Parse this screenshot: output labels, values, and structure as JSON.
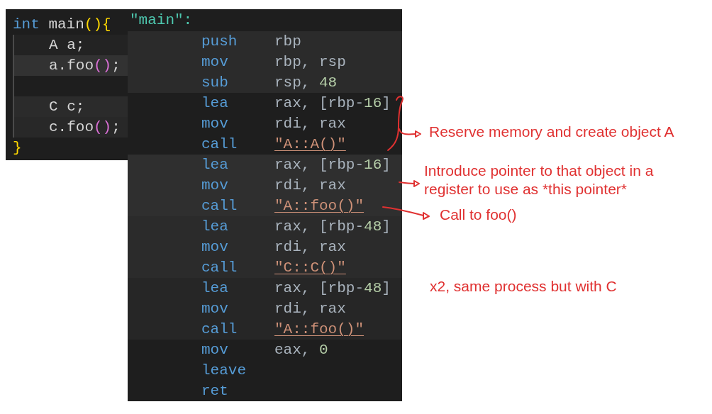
{
  "source": {
    "lines": [
      {
        "kind": "code",
        "tokens": [
          {
            "text": "int",
            "kind": "keyword"
          },
          {
            "text": " main",
            "kind": "identifier"
          },
          {
            "text": "(){",
            "kind": "bracket"
          }
        ],
        "children": [
          {
            "kind": "code",
            "color": "#232323",
            "tokens": [
              {
                "text": "A a;",
                "kind": "identifier"
              }
            ]
          },
          {
            "kind": "code",
            "color": "#323232",
            "tokens": [
              {
                "text": "a.foo",
                "kind": "identifier"
              },
              {
                "text": "()",
                "kind": "subbracket"
              },
              {
                "text": ";",
                "kind": "identifier"
              }
            ]
          },
          {
            "kind": "blank"
          },
          {
            "kind": "code",
            "color": "#2b2b2b",
            "tokens": [
              {
                "text": "C c;",
                "kind": "identifier"
              }
            ]
          },
          {
            "kind": "code",
            "color": "#282828",
            "tokens": [
              {
                "text": "c.foo",
                "kind": "identifier"
              },
              {
                "text": "()",
                "kind": "subbracket"
              },
              {
                "text": ";",
                "kind": "identifier"
              }
            ]
          }
        ]
      },
      {
        "kind": "code",
        "tokens": [
          {
            "text": "}",
            "kind": "bracket"
          }
        ]
      }
    ]
  },
  "assembly": {
    "label": "\"main\":",
    "blocks": [
      {
        "color": "#2b2b2b",
        "rows": [
          {
            "mnemonic": "push",
            "operands": [
              {
                "text": "rbp",
                "kind": "register"
              }
            ]
          },
          {
            "mnemonic": "mov",
            "operands": [
              {
                "text": "rbp, rsp",
                "kind": "register"
              }
            ]
          },
          {
            "mnemonic": "sub",
            "operands": [
              {
                "text": "rsp, ",
                "kind": "register"
              },
              {
                "text": "48",
                "kind": "number"
              }
            ]
          }
        ]
      },
      {
        "rows": [
          {
            "mnemonic": "lea",
            "operands": [
              {
                "text": "rax, [rbp-",
                "kind": "register"
              },
              {
                "text": "16",
                "kind": "number"
              },
              {
                "text": "]",
                "kind": "register"
              }
            ]
          },
          {
            "mnemonic": "mov",
            "operands": [
              {
                "text": "rdi, rax",
                "kind": "register"
              }
            ]
          },
          {
            "mnemonic": "call",
            "target": "\"A::A()\""
          }
        ]
      },
      {
        "color": "#2f2f2f",
        "rows": [
          {
            "mnemonic": "lea",
            "operands": [
              {
                "text": "rax, [rbp-",
                "kind": "register"
              },
              {
                "text": "16",
                "kind": "number"
              },
              {
                "text": "]",
                "kind": "register"
              }
            ]
          },
          {
            "mnemonic": "mov",
            "operands": [
              {
                "text": "rdi, rax",
                "kind": "register"
              }
            ]
          },
          {
            "mnemonic": "call",
            "target": "\"A::foo()\""
          }
        ]
      },
      {
        "color": "#2b2b2b",
        "rows": [
          {
            "mnemonic": "lea",
            "operands": [
              {
                "text": "rax, [rbp-",
                "kind": "register"
              },
              {
                "text": "48",
                "kind": "number"
              },
              {
                "text": "]",
                "kind": "register"
              }
            ]
          },
          {
            "mnemonic": "mov",
            "operands": [
              {
                "text": "rdi, rax",
                "kind": "register"
              }
            ]
          },
          {
            "mnemonic": "call",
            "target": "\"C::C()\""
          }
        ]
      },
      {
        "color": "#262626",
        "rows": [
          {
            "mnemonic": "lea",
            "operands": [
              {
                "text": "rax, [rbp-",
                "kind": "register"
              },
              {
                "text": "48",
                "kind": "number"
              },
              {
                "text": "]",
                "kind": "register"
              }
            ]
          },
          {
            "mnemonic": "mov",
            "operands": [
              {
                "text": "rdi, rax",
                "kind": "register"
              }
            ]
          },
          {
            "mnemonic": "call",
            "target": "\"A::foo()\""
          }
        ]
      },
      {
        "rows": [
          {
            "mnemonic": "mov",
            "operands": [
              {
                "text": "eax, ",
                "kind": "register"
              },
              {
                "text": "0",
                "kind": "number"
              }
            ]
          },
          {
            "mnemonic": "leave"
          },
          {
            "mnemonic": "ret"
          }
        ]
      }
    ]
  },
  "annotations": [
    {
      "text": "Reserve memory and create object A"
    },
    {
      "text": "Introduce pointer to that object in a register to use as *this pointer*"
    },
    {
      "text": "Call to foo()"
    },
    {
      "text": "x2, same process but with C"
    }
  ]
}
